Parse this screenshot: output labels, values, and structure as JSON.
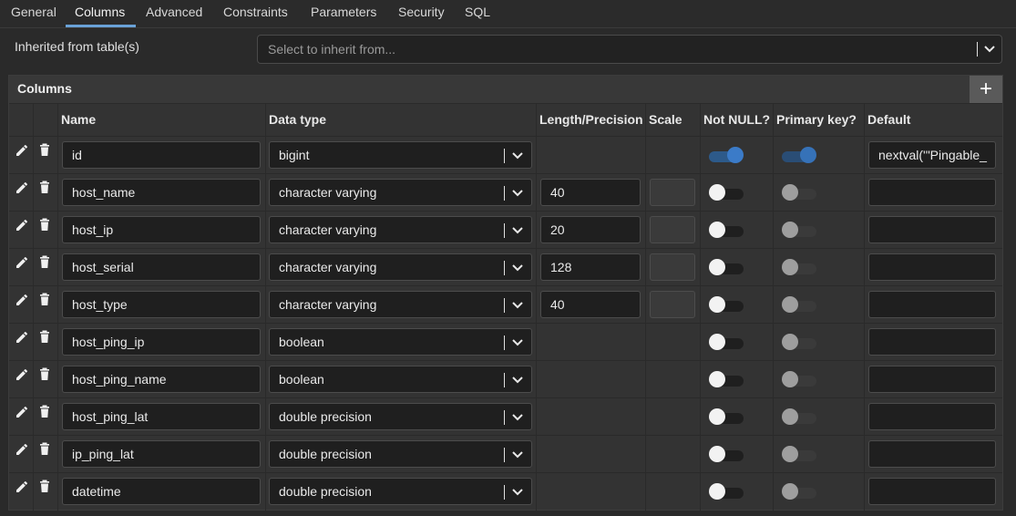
{
  "tabs": [
    "General",
    "Columns",
    "Advanced",
    "Constraints",
    "Parameters",
    "Security",
    "SQL"
  ],
  "active_tab": "Columns",
  "inherit": {
    "label": "Inherited from table(s)",
    "placeholder": "Select to inherit from..."
  },
  "panel": {
    "title": "Columns",
    "add_label": "+"
  },
  "headers": {
    "name": "Name",
    "data_type": "Data type",
    "length": "Length/Precision",
    "scale": "Scale",
    "not_null": "Not NULL?",
    "primary_key": "Primary key?",
    "default": "Default"
  },
  "colors": {
    "accent": "#3b7bc8",
    "background": "#2a2a2a",
    "input": "#1f1f1f"
  },
  "icons": {
    "edit": "pencil-icon",
    "delete": "trash-icon",
    "dropdown": "chevron-down-icon",
    "add": "plus-icon"
  },
  "rows": [
    {
      "name": "id",
      "type": "bigint",
      "length": "",
      "scale_field": false,
      "not_null": true,
      "primary_key": true,
      "default": "nextval('\"Pingable_"
    },
    {
      "name": "host_name",
      "type": "character varying",
      "length": "40",
      "scale_field": true,
      "not_null": false,
      "primary_key": false,
      "default": ""
    },
    {
      "name": "host_ip",
      "type": "character varying",
      "length": "20",
      "scale_field": true,
      "not_null": false,
      "primary_key": false,
      "default": ""
    },
    {
      "name": "host_serial",
      "type": "character varying",
      "length": "128",
      "scale_field": true,
      "not_null": false,
      "primary_key": false,
      "default": ""
    },
    {
      "name": "host_type",
      "type": "character varying",
      "length": "40",
      "scale_field": true,
      "not_null": false,
      "primary_key": false,
      "default": ""
    },
    {
      "name": "host_ping_ip",
      "type": "boolean",
      "length": null,
      "scale_field": false,
      "not_null": false,
      "primary_key": false,
      "default": ""
    },
    {
      "name": "host_ping_name",
      "type": "boolean",
      "length": null,
      "scale_field": false,
      "not_null": false,
      "primary_key": false,
      "default": ""
    },
    {
      "name": "host_ping_lat",
      "type": "double precision",
      "length": null,
      "scale_field": false,
      "not_null": false,
      "primary_key": false,
      "default": ""
    },
    {
      "name": "ip_ping_lat",
      "type": "double precision",
      "length": null,
      "scale_field": false,
      "not_null": false,
      "primary_key": false,
      "default": ""
    },
    {
      "name": "datetime",
      "type": "double precision",
      "length": null,
      "scale_field": false,
      "not_null": false,
      "primary_key": false,
      "default": ""
    }
  ]
}
